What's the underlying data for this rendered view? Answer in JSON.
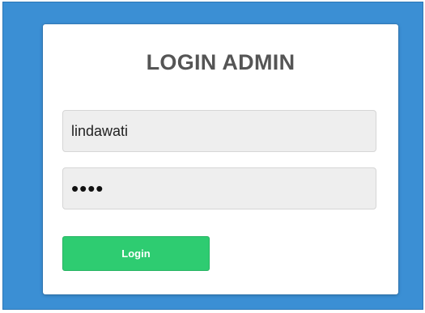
{
  "login": {
    "title": "LOGIN ADMIN",
    "username_value": "lindawati",
    "password_value": "abcd",
    "button_label": "Login"
  },
  "colors": {
    "background": "#3b8fd4",
    "card": "#ffffff",
    "field_bg": "#eeeeee",
    "button": "#2ecc71",
    "title": "#555555"
  }
}
